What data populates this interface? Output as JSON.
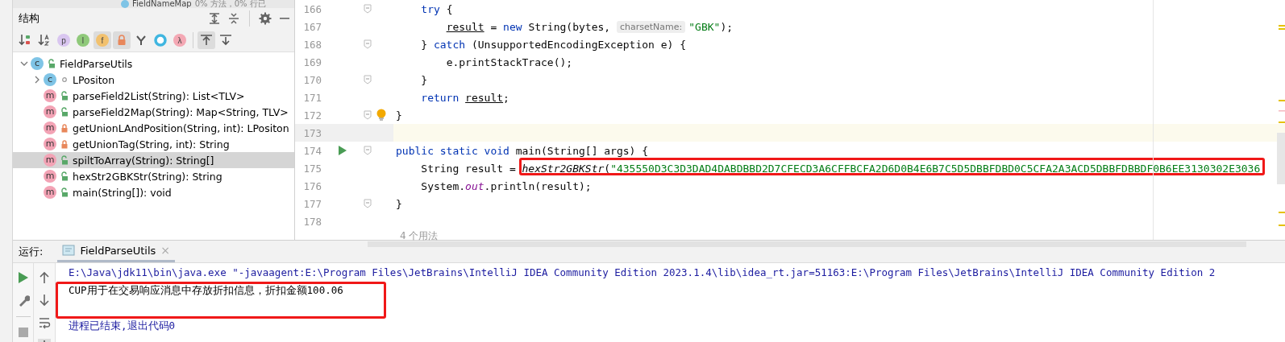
{
  "background_row": {
    "name": "FieldNameMap",
    "coverage": "0% 方法，0% 行已"
  },
  "structure": {
    "title": "结构",
    "toolbar": [
      {
        "kind": "sort-visibility",
        "selected": false
      },
      {
        "kind": "sort-alpha",
        "selected": false
      },
      {
        "kind": "letter",
        "glyph": "p",
        "color": "#d9c6f0",
        "selected": false
      },
      {
        "kind": "letter",
        "glyph": "I",
        "color": "#8fc97a",
        "selected": false
      },
      {
        "kind": "letter",
        "glyph": "f",
        "color": "#f2c16e",
        "selected": true
      },
      {
        "kind": "lock",
        "selected": true
      },
      {
        "kind": "merge",
        "selected": false
      },
      {
        "kind": "ring",
        "selected": false
      },
      {
        "kind": "letter",
        "glyph": "λ",
        "color": "#f4a8b4",
        "selected": false
      },
      {
        "kind": "sep"
      },
      {
        "kind": "autoscroll-to",
        "selected": true
      },
      {
        "kind": "autoscroll-from",
        "selected": false
      }
    ],
    "tree": [
      {
        "name": "FieldParseUtils",
        "kind": "class",
        "badge": "c",
        "locked": false,
        "expanded": true,
        "selected": false,
        "children": [
          {
            "name": "LPositon",
            "kind": "class",
            "badge": "c",
            "package_local": true,
            "expanded": false,
            "selected": false
          },
          {
            "name": "parseField2List(String): List<TLV>",
            "kind": "method",
            "badge": "m",
            "locked": false,
            "selected": false
          },
          {
            "name": "parseField2Map(String): Map<String, TLV>",
            "kind": "method",
            "badge": "m",
            "locked": false,
            "selected": false
          },
          {
            "name": "getUnionLAndPosition(String, int): LPositon",
            "kind": "method",
            "badge": "m",
            "locked": true,
            "selected": false
          },
          {
            "name": "getUnionTag(String, int): String",
            "kind": "method",
            "badge": "m",
            "locked": true,
            "selected": false
          },
          {
            "name": "spiltToArray(String): String[]",
            "kind": "method",
            "badge": "m",
            "locked": false,
            "selected": true
          },
          {
            "name": "hexStr2GBKStr(String): String",
            "kind": "method",
            "badge": "m",
            "locked": false,
            "selected": false
          },
          {
            "name": "main(String[]): void",
            "kind": "method",
            "badge": "m",
            "locked": false,
            "selected": false
          }
        ]
      }
    ]
  },
  "editor": {
    "lines": [
      {
        "number": "166",
        "fold": true,
        "run": false,
        "bulb": false,
        "current": false,
        "highlight": false,
        "tokens": [
          {
            "kind": "keyword",
            "text": "    try"
          },
          {
            "kind": "plain",
            "text": " {"
          }
        ]
      },
      {
        "number": "167",
        "fold": false,
        "run": false,
        "bulb": false,
        "current": false,
        "highlight": false,
        "tokens": [
          {
            "kind": "variable",
            "text": "        result"
          },
          {
            "kind": "plain",
            "text": " = "
          },
          {
            "kind": "keyword",
            "text": "new"
          },
          {
            "kind": "plain",
            "text": " String(bytes, "
          },
          {
            "kind": "hint",
            "text": "charsetName:"
          },
          {
            "kind": "string",
            "text": "\"GBK\""
          },
          {
            "kind": "plain",
            "text": ");"
          }
        ]
      },
      {
        "number": "168",
        "fold": true,
        "run": false,
        "bulb": false,
        "current": false,
        "highlight": false,
        "tokens": [
          {
            "kind": "plain",
            "text": "    } "
          },
          {
            "kind": "keyword",
            "text": "catch"
          },
          {
            "kind": "plain",
            "text": " (UnsupportedEncodingException e) {"
          }
        ]
      },
      {
        "number": "169",
        "fold": false,
        "run": false,
        "bulb": false,
        "current": false,
        "highlight": false,
        "tokens": [
          {
            "kind": "plain",
            "text": "        e.printStackTrace();"
          }
        ]
      },
      {
        "number": "170",
        "fold": true,
        "run": false,
        "bulb": false,
        "current": false,
        "highlight": false,
        "tokens": [
          {
            "kind": "plain",
            "text": "    }"
          }
        ]
      },
      {
        "number": "171",
        "fold": false,
        "run": false,
        "bulb": false,
        "current": false,
        "highlight": false,
        "tokens": [
          {
            "kind": "keyword",
            "text": "    return"
          },
          {
            "kind": "variable",
            "text": " result"
          },
          {
            "kind": "plain",
            "text": ";"
          }
        ]
      },
      {
        "number": "172",
        "fold": true,
        "run": false,
        "bulb": true,
        "current": false,
        "highlight": false,
        "tokens": [
          {
            "kind": "plain",
            "text": "}"
          }
        ]
      },
      {
        "number": "173",
        "fold": false,
        "run": false,
        "bulb": false,
        "current": true,
        "highlight": false
      },
      {
        "number": "174",
        "fold": true,
        "run": true,
        "bulb": false,
        "current": false,
        "highlight": false,
        "tokens": [
          {
            "kind": "keyword",
            "text": "public static void"
          },
          {
            "kind": "plain",
            "text": " main(String[] args) {"
          }
        ]
      },
      {
        "number": "175",
        "fold": false,
        "run": false,
        "bulb": false,
        "current": false,
        "highlight": true,
        "tokens": [
          {
            "kind": "plain",
            "text": "    String result = "
          },
          {
            "kind": "call",
            "text": "hexStr2GBKStr"
          },
          {
            "kind": "plain",
            "text": "("
          },
          {
            "kind": "string",
            "text": "\"435550D3C3D3DAD4DABDBBD2D7CFECD3A6CFFBCFA2D6D0B4E6B7C5D5DBBFDBD0C5CFA2A3ACD5DBBFDBBDF0B6EE3130302E3036"
          }
        ]
      },
      {
        "number": "176",
        "fold": false,
        "run": false,
        "bulb": false,
        "current": false,
        "highlight": false,
        "tokens": [
          {
            "kind": "plain",
            "text": "    System."
          },
          {
            "kind": "field",
            "text": "out"
          },
          {
            "kind": "plain",
            "text": ".println(result);"
          }
        ]
      },
      {
        "number": "177",
        "fold": true,
        "run": false,
        "bulb": false,
        "current": false,
        "highlight": false,
        "tokens": [
          {
            "kind": "plain",
            "text": "}"
          }
        ]
      },
      {
        "number": "178",
        "fold": false,
        "run": false,
        "bulb": false,
        "current": false,
        "highlight": false
      }
    ],
    "usages": "4 个用法"
  },
  "run_panel": {
    "label": "运行:",
    "tabs": [
      {
        "label": "FieldParseUtils",
        "close": "×",
        "selected": true
      }
    ],
    "console": [
      {
        "kind": "command",
        "text": "E:\\Java\\jdk11\\bin\\java.exe \"-javaagent:E:\\Program Files\\JetBrains\\IntelliJ IDEA Community Edition 2023.1.4\\lib\\idea_rt.jar=51163:E:\\Program Files\\JetBrains\\IntelliJ IDEA Community Edition 2",
        "highlight": false
      },
      {
        "kind": "output",
        "text": "CUP用于在交易响应消息中存放折扣信息，折扣金额100.06",
        "highlight": true
      },
      {
        "kind": "blank",
        "highlight": false
      },
      {
        "kind": "command",
        "text": "进程已结束,退出代码0",
        "highlight": false
      }
    ]
  }
}
